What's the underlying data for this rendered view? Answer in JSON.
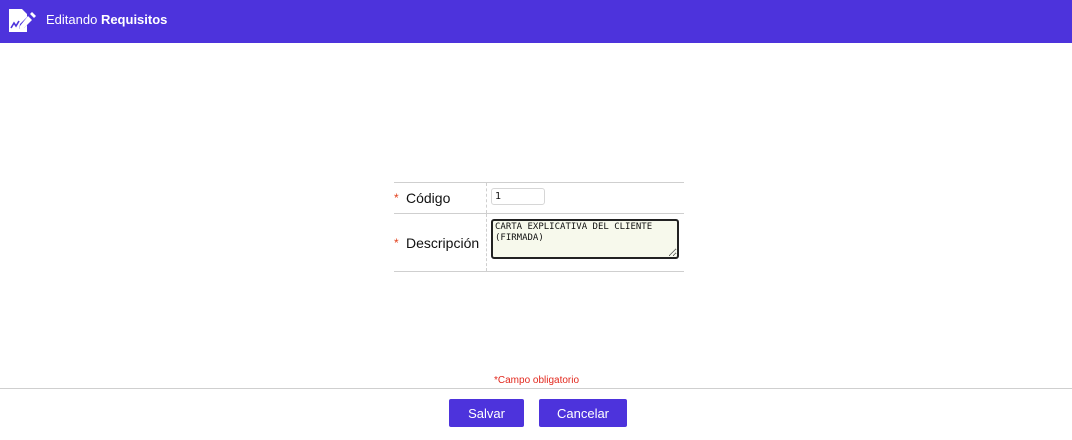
{
  "header": {
    "title_prefix": "Editando ",
    "title_entity": "Requisitos",
    "icon": "edit-document-icon"
  },
  "form": {
    "fields": [
      {
        "required_mark": "*",
        "label": "Código",
        "value": "1"
      },
      {
        "required_mark": "*",
        "label": "Descripción",
        "value": "CARTA EXPLICATIVA DEL CLIENTE\n(FIRMADA)"
      }
    ]
  },
  "required_note": "*Campo obligatorio",
  "actions": {
    "save_label": "Salvar",
    "cancel_label": "Cancelar"
  },
  "colors": {
    "accent": "#4d33dc",
    "required": "#e2411d",
    "textarea_bg": "#f7f9ec"
  }
}
